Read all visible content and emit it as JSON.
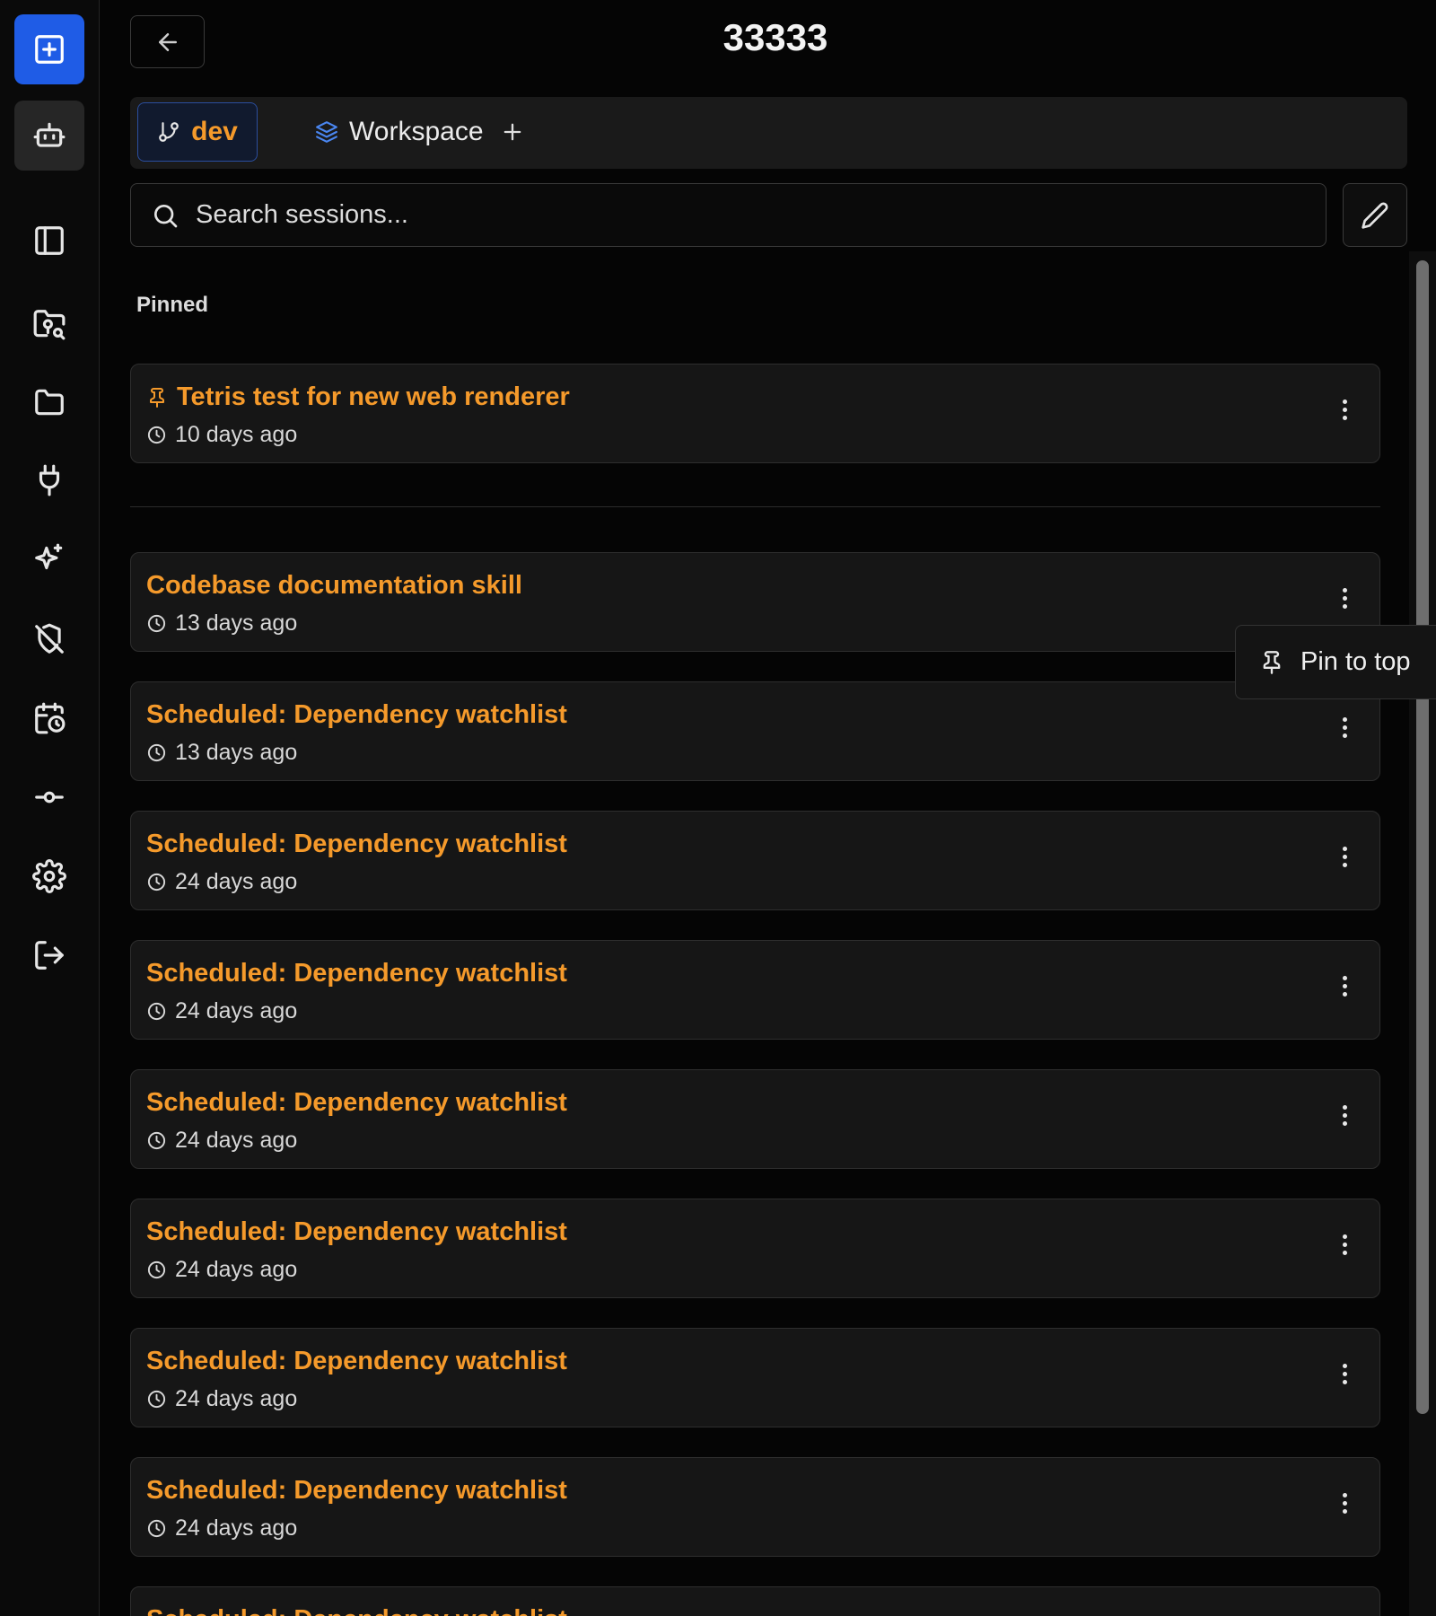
{
  "sidebar": {
    "items": [
      {
        "name": "new-session-button",
        "icon": "plus-square-icon"
      },
      {
        "name": "agent-button",
        "icon": "robot-icon"
      },
      {
        "name": "toggle-panel-button",
        "icon": "sidebar-panel-icon"
      },
      {
        "name": "project-search-button",
        "icon": "folder-search-icon"
      },
      {
        "name": "files-button",
        "icon": "folder-icon"
      },
      {
        "name": "plugins-button",
        "icon": "plug-icon"
      },
      {
        "name": "skills-button",
        "icon": "sparkles-icon"
      },
      {
        "name": "security-button",
        "icon": "shield-off-icon"
      },
      {
        "name": "schedule-button",
        "icon": "calendar-clock-icon"
      },
      {
        "name": "commit-button",
        "icon": "git-commit-icon"
      },
      {
        "name": "settings-button",
        "icon": "gear-icon"
      },
      {
        "name": "logout-button",
        "icon": "logout-icon"
      }
    ]
  },
  "header": {
    "title": "33333"
  },
  "tabs": {
    "branch_label": "dev",
    "workspace_label": "Workspace"
  },
  "search": {
    "placeholder": "Search sessions..."
  },
  "pinned": {
    "label": "Pinned",
    "sessions": [
      {
        "title": "Tetris test for new web renderer",
        "time": "10 days ago"
      }
    ]
  },
  "sessions": [
    {
      "title": "Codebase documentation skill",
      "time": "13 days ago"
    },
    {
      "title": "Scheduled: Dependency watchlist",
      "time": "13 days ago"
    },
    {
      "title": "Scheduled: Dependency watchlist",
      "time": "24 days ago"
    },
    {
      "title": "Scheduled: Dependency watchlist",
      "time": "24 days ago"
    },
    {
      "title": "Scheduled: Dependency watchlist",
      "time": "24 days ago"
    },
    {
      "title": "Scheduled: Dependency watchlist",
      "time": "24 days ago"
    },
    {
      "title": "Scheduled: Dependency watchlist",
      "time": "24 days ago"
    },
    {
      "title": "Scheduled: Dependency watchlist",
      "time": "24 days ago"
    },
    {
      "title": "Scheduled: Dependency watchlist",
      "time": ""
    }
  ],
  "context_menu": {
    "pin_label": "Pin to top"
  },
  "colors": {
    "accent": "#f59a2b",
    "primary": "#1f5ce6",
    "background": "#050505",
    "card": "#161616"
  }
}
